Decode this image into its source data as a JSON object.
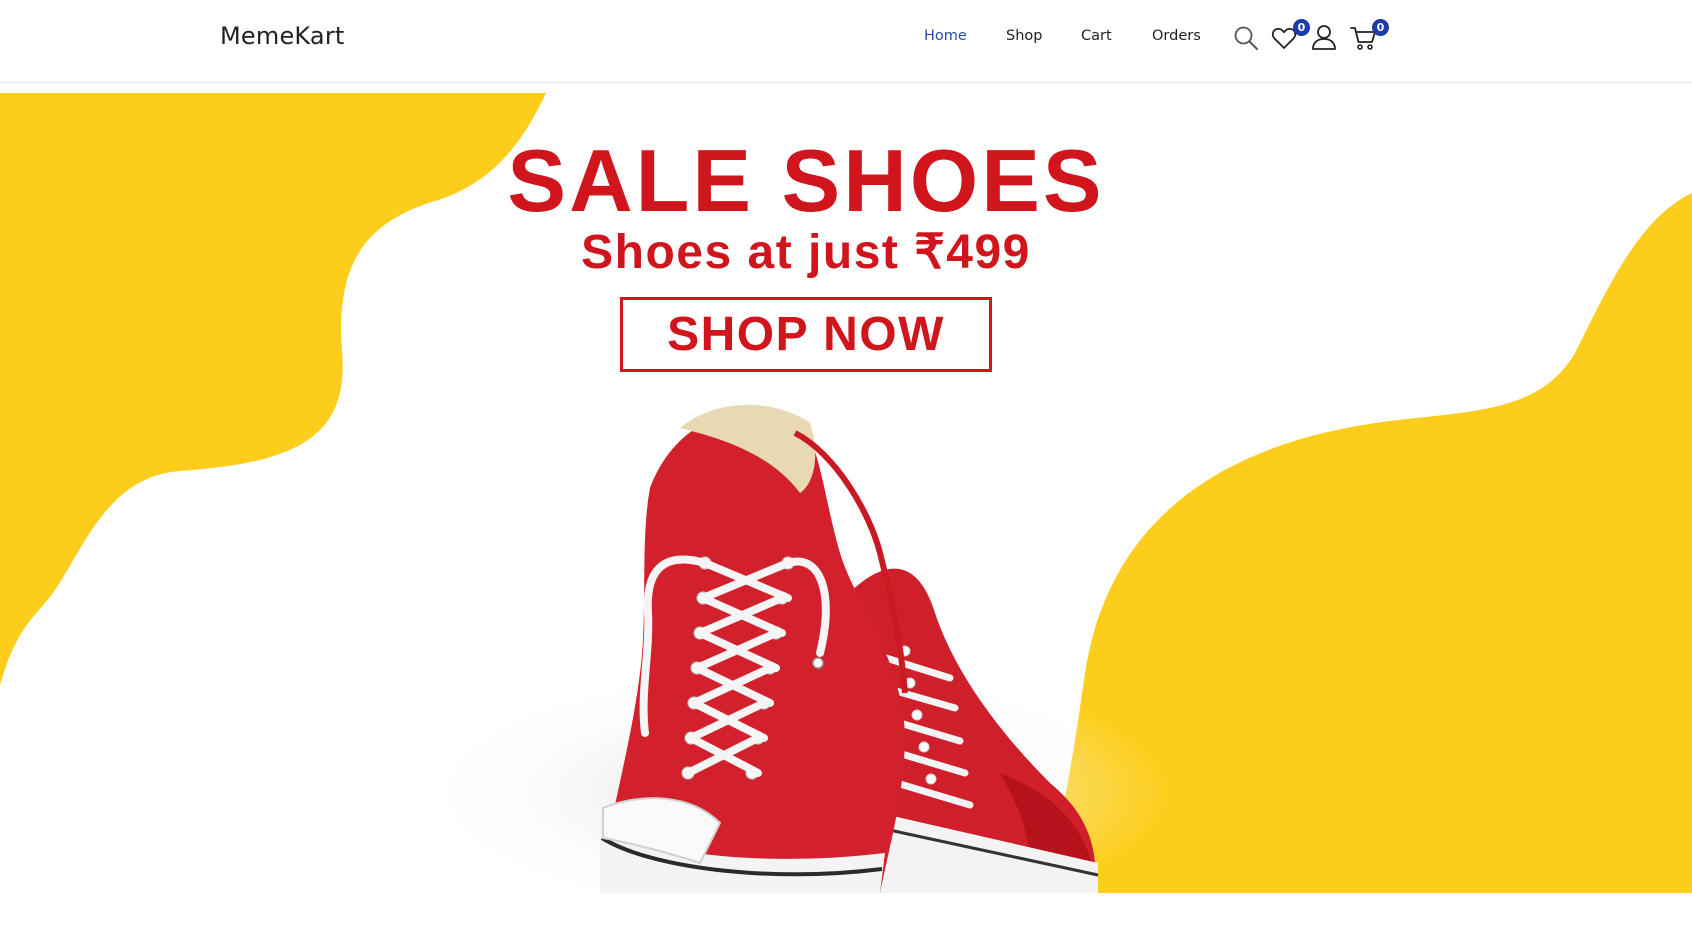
{
  "brand": {
    "name": "MemeKart"
  },
  "nav": {
    "items": [
      {
        "label": "Home",
        "active": true
      },
      {
        "label": "Shop",
        "active": false
      },
      {
        "label": "Cart",
        "active": false
      },
      {
        "label": "Orders",
        "active": false
      }
    ],
    "icons": {
      "search": "search-icon",
      "wishlist": "heart-icon",
      "account": "user-icon",
      "cart": "cart-icon"
    },
    "wishlist_count": "0",
    "cart_count": "0"
  },
  "hero": {
    "title": "SALE SHOES",
    "subtitle": "Shoes at just ₹499",
    "cta_label": "SHOP NOW",
    "image": "red-high-top-sneakers"
  },
  "colors": {
    "accent_yellow": "#fcce1b",
    "promo_red": "#d0161c",
    "badge_blue": "#1c3aa9",
    "active_nav": "#2c4a9e"
  }
}
